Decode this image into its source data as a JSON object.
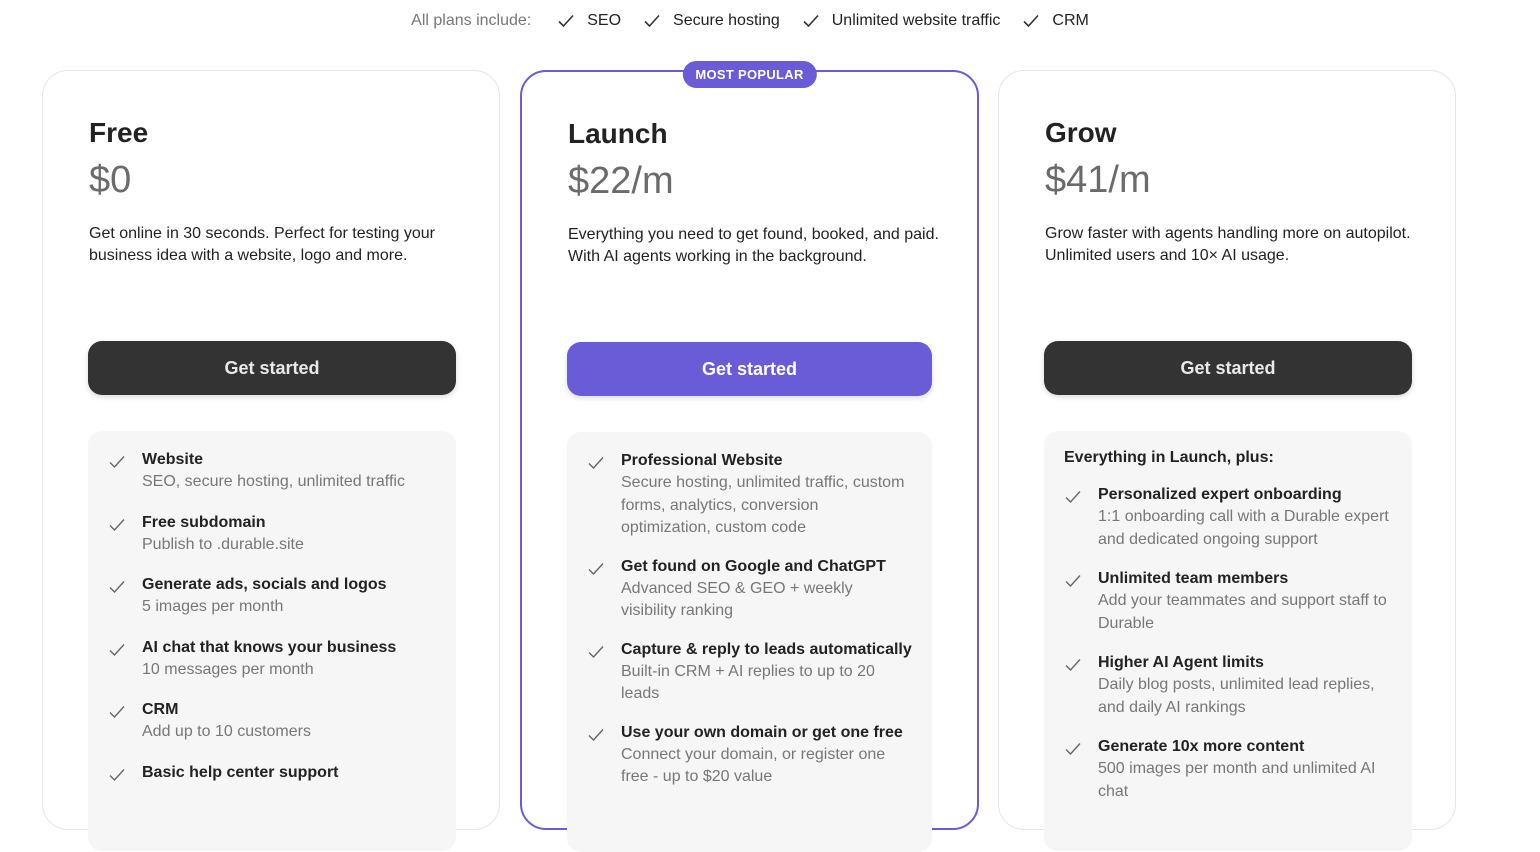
{
  "includes": {
    "lead": "All plans include:",
    "items": [
      "SEO",
      "Secure hosting",
      "Unlimited website traffic",
      "CRM"
    ]
  },
  "plans": [
    {
      "name": "Free",
      "price": "$0",
      "description": "Get online in 30 seconds. Perfect for testing your business idea with a website, logo and more.",
      "cta": "Get started",
      "features_intro": "",
      "features": [
        {
          "title": "Website",
          "sub": "SEO, secure hosting, unlimited traffic"
        },
        {
          "title": "Free subdomain",
          "sub": "Publish to .durable.site"
        },
        {
          "title": "Generate ads, socials and logos",
          "sub": "5 images per month"
        },
        {
          "title": "AI chat that knows your business",
          "sub": "10 messages per month"
        },
        {
          "title": "CRM",
          "sub": "Add up to 10 customers"
        },
        {
          "title": "Basic help center support",
          "sub": ""
        }
      ]
    },
    {
      "name": "Launch",
      "badge": "MOST POPULAR",
      "price": "$22/m",
      "description": "Everything you need to get found, booked, and paid. With AI agents working in the background.",
      "cta": "Get started",
      "features_intro": "",
      "features": [
        {
          "title": "Professional Website",
          "sub": "Secure hosting, unlimited traffic, custom forms, analytics, conversion optimization, custom code"
        },
        {
          "title": "Get found on Google and ChatGPT",
          "sub": "Advanced SEO & GEO + weekly visibility ranking"
        },
        {
          "title": "Capture & reply to leads automatically",
          "sub": "Built-in CRM + AI replies to up to 20 leads"
        },
        {
          "title": "Use your own domain or get one free",
          "sub": "Connect your domain, or register one free - up to $20 value"
        }
      ]
    },
    {
      "name": "Grow",
      "price": "$41/m",
      "description": "Grow faster with agents handling more on autopilot. Unlimited users and 10× AI usage.",
      "cta": "Get started",
      "features_intro": "Everything in Launch, plus:",
      "features": [
        {
          "title": "Personalized expert onboarding",
          "sub": "1:1 onboarding call with a Durable expert and dedicated ongoing support"
        },
        {
          "title": "Unlimited team members",
          "sub": "Add your teammates and support staff to Durable"
        },
        {
          "title": "Higher AI Agent limits",
          "sub": "Daily blog posts, unlimited lead replies, and daily AI rankings"
        },
        {
          "title": "Generate 10x more content",
          "sub": "500 images per month and unlimited AI chat"
        }
      ]
    }
  ],
  "colors": {
    "accent": "#6a5bd6",
    "dark_button": "#333333",
    "feature_bg": "#f6f6f6"
  },
  "icons": {
    "check": "check-icon"
  }
}
